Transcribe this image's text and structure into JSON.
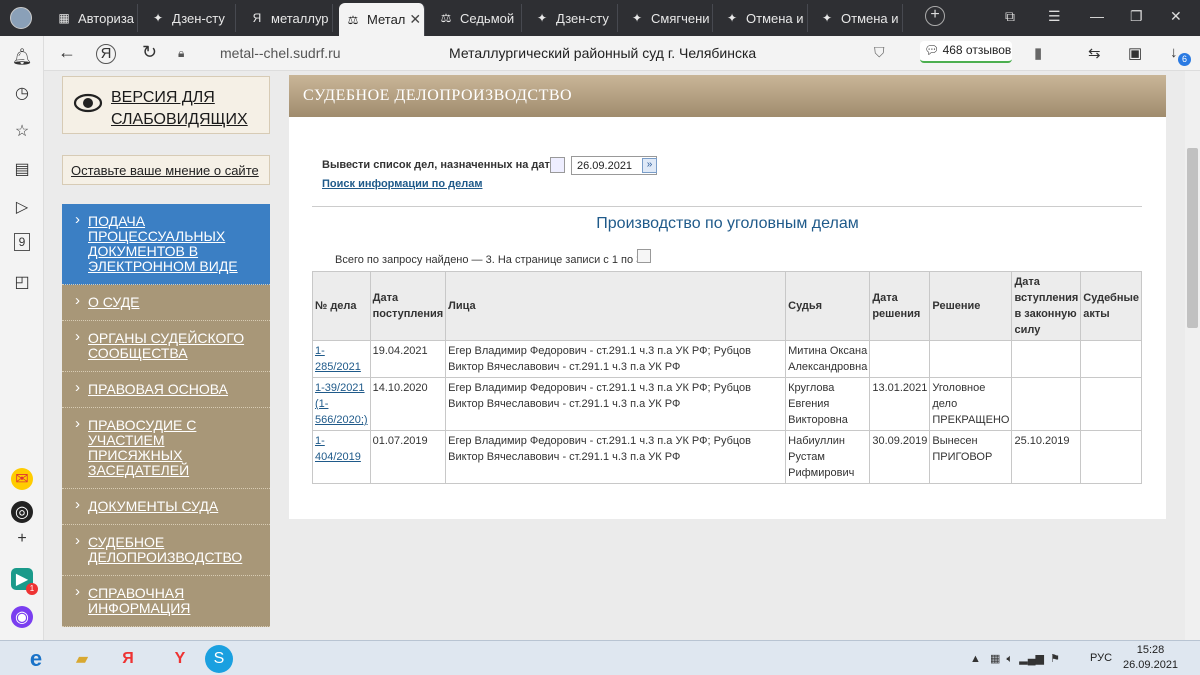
{
  "tabs": [
    {
      "label": "Авториза",
      "icon": "vk-icon"
    },
    {
      "label": "Дзен-сту",
      "icon": "dzen-icon"
    },
    {
      "label": "металлур",
      "icon": "yandex-icon"
    },
    {
      "label": "Метал",
      "icon": "court-icon",
      "active": true
    },
    {
      "label": "Седьмой",
      "icon": "court-icon"
    },
    {
      "label": "Дзен-сту",
      "icon": "dzen-icon"
    },
    {
      "label": "Смягчени",
      "icon": "dzen-icon"
    },
    {
      "label": "Отмена и",
      "icon": "dzen-icon"
    },
    {
      "label": "Отмена и",
      "icon": "dzen-icon"
    }
  ],
  "address": {
    "url": "metal--chel.sudrf.ru",
    "title": "Металлургический районный суд г. Челябинска",
    "reviews": "468 отзывов",
    "downloads_badge": "6",
    "badge_one": "1"
  },
  "side": {
    "visually_impaired": "ВЕРСИЯ ДЛЯ СЛАБОВИДЯЩИХ",
    "opinion": "Оставьте ваше мнение о сайте",
    "menu": [
      "ПОДАЧА ПРОЦЕССУАЛЬНЫХ ДОКУМЕНТОВ В ЭЛЕКТРОННОМ ВИДЕ",
      "О СУДЕ",
      "ОРГАНЫ СУДЕЙСКОГО СООБЩЕСТВА",
      "ПРАВОВАЯ ОСНОВА",
      "ПРАВОСУДИЕ С УЧАСТИЕМ ПРИСЯЖНЫХ ЗАСЕДАТЕЛЕЙ",
      "ДОКУМЕНТЫ СУДА",
      "СУДЕБНОЕ ДЕЛОПРОИЗВОДСТВО",
      "СПРАВОЧНАЯ ИНФОРМАЦИЯ"
    ]
  },
  "content": {
    "header": "СУДЕБНОЕ ДЕЛОПРОИЗВОДСТВО",
    "date_label": "Вывести список дел, назначенных на дату",
    "date_value": "26.09.2021",
    "search_link": "Поиск информации по делам",
    "section_title": "Производство по уголовным делам",
    "found_text": "Всего по запросу найдено — 3. На странице записи с 1 по 3.",
    "table": {
      "headers": [
        "№ дела",
        "Дата поступления",
        "Лица",
        "Судья",
        "Дата решения",
        "Решение",
        "Дата вступления в законную силу",
        "Судебные акты"
      ],
      "rows": [
        {
          "case": "1-285/2021",
          "received": "19.04.2021",
          "persons": "Егер Владимир Федорович - ст.291.1 ч.3 п.а УК РФ; Рубцов Виктор Вячеславович - ст.291.1 ч.3 п.а УК РФ",
          "judge": "Митина Оксана Александровна",
          "decision_date": "",
          "decision": "",
          "effective": "",
          "acts": ""
        },
        {
          "case": "1-39/2021 (1-566/2020;)",
          "received": "14.10.2020",
          "persons": "Егер Владимир Федорович - ст.291.1 ч.3 п.а УК РФ; Рубцов Виктор Вячеславович - ст.291.1 ч.3 п.а УК РФ",
          "judge": "Круглова Евгения Викторовна",
          "decision_date": "13.01.2021",
          "decision": "Уголовное дело ПРЕКРАЩЕНО",
          "effective": "",
          "acts": ""
        },
        {
          "case": "1-404/2019",
          "received": "01.07.2019",
          "persons": "Егер Владимир Федорович - ст.291.1 ч.3 п.а УК РФ; Рубцов Виктор Вячеславович - ст.291.1 ч.3 п.а УК РФ",
          "judge": "Набиуллин Рустам Рифмирович",
          "decision_date": "30.09.2019",
          "decision": "Вынесен ПРИГОВОР",
          "effective": "25.10.2019",
          "acts": ""
        }
      ]
    }
  },
  "taskbar": {
    "time": "15:28",
    "date": "26.09.2021",
    "lang": "РУС"
  }
}
